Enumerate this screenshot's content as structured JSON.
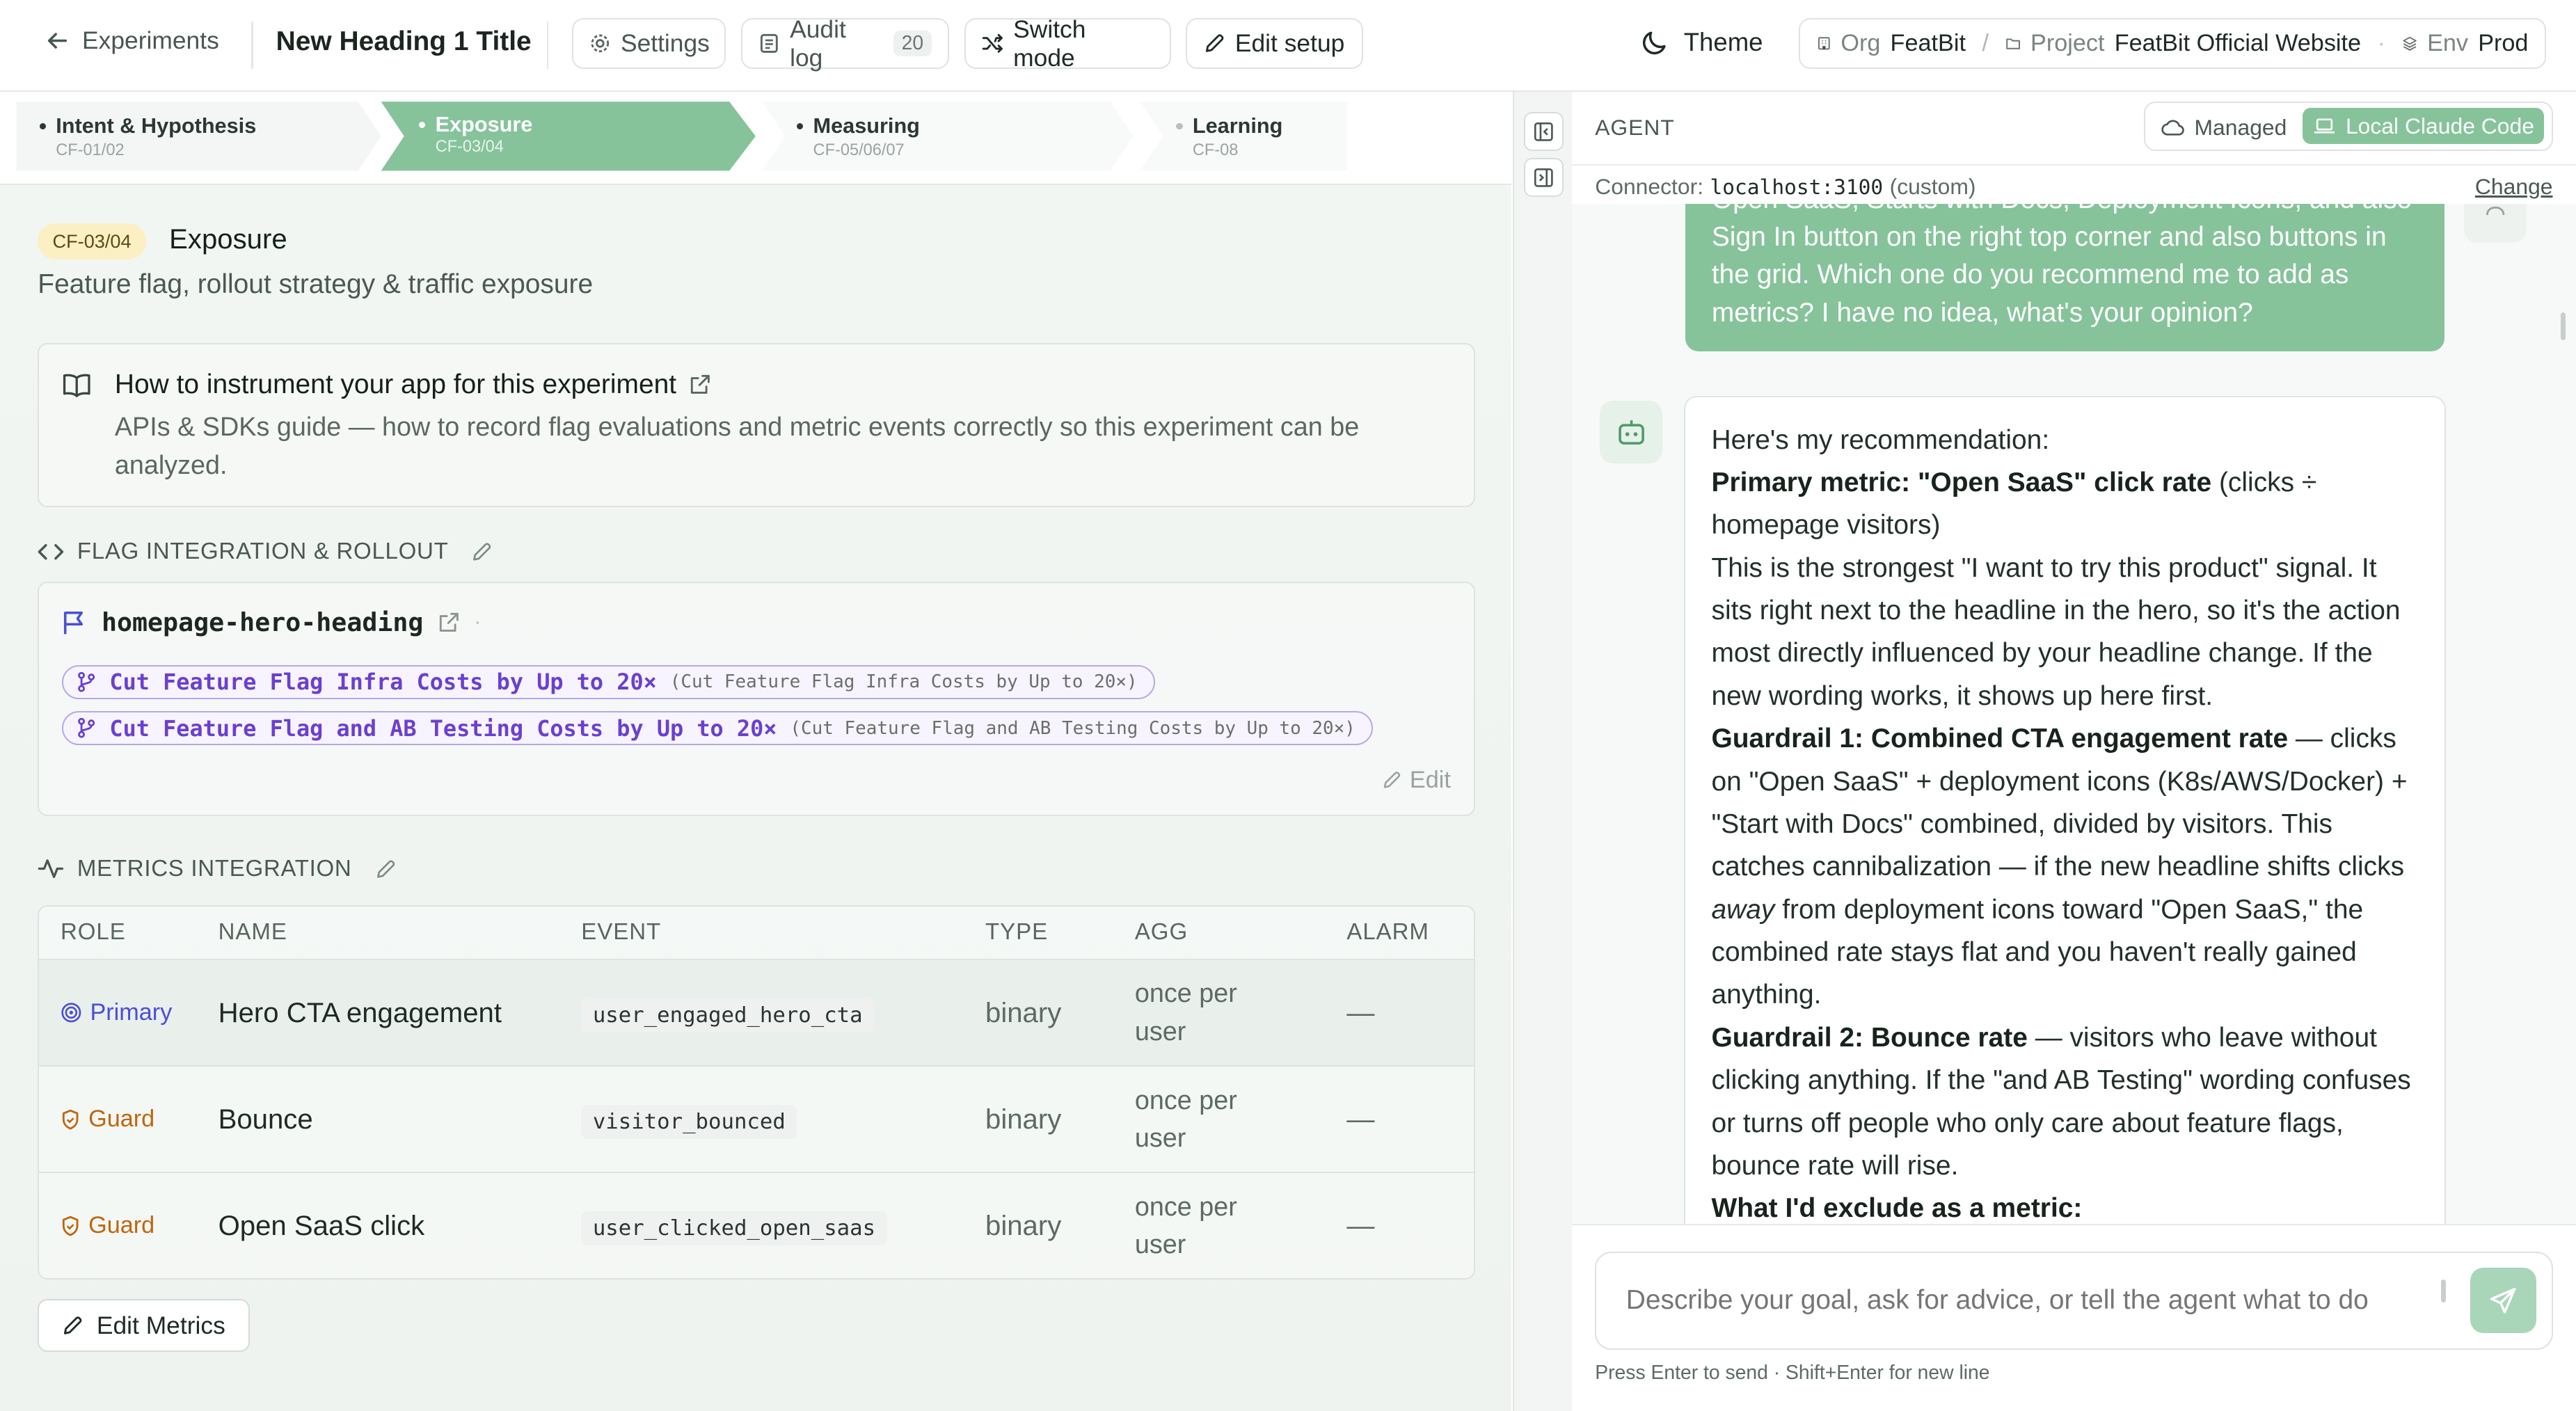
{
  "topbar": {
    "back_label": "Experiments",
    "title": "New Heading 1 Title",
    "settings_label": "Settings",
    "audit_label": "Audit log",
    "audit_count": "20",
    "switch_label": "Switch mode",
    "edit_setup_label": "Edit setup",
    "theme_label": "Theme",
    "org_key": "Org",
    "org_value": "FeatBit",
    "sep": "/",
    "project_key": "Project",
    "project_value": "FeatBit Official Website",
    "env_key": "Env",
    "env_value": "Prod"
  },
  "stepper": [
    {
      "title": "Intent & Hypothesis",
      "sub": "CF-01/02"
    },
    {
      "title": "Exposure",
      "sub": "CF-03/04"
    },
    {
      "title": "Measuring",
      "sub": "CF-05/06/07"
    },
    {
      "title": "Learning",
      "sub": "CF-08"
    }
  ],
  "exposure": {
    "badge": "CF-03/04",
    "title": "Exposure",
    "subtitle": "Feature flag, rollout strategy & traffic exposure"
  },
  "guide": {
    "title": "How to instrument your app for this experiment",
    "desc": "APIs & SDKs guide — how to record flag evaluations and metric events correctly so this experiment can be analyzed."
  },
  "flag_section": {
    "heading": "FLAG INTEGRATION & ROLLOUT",
    "flag_key": "homepage-hero-heading",
    "variants": [
      {
        "name": "Cut Feature Flag Infra Costs by Up to 20×",
        "value": "(Cut Feature Flag Infra Costs by Up to 20×)"
      },
      {
        "name": "Cut Feature Flag and AB Testing Costs by Up to 20×",
        "value": "(Cut Feature Flag and AB Testing Costs by Up to 20×)"
      }
    ],
    "edit_label": "Edit"
  },
  "metrics_section": {
    "heading": "METRICS INTEGRATION",
    "columns": [
      "ROLE",
      "NAME",
      "EVENT",
      "TYPE",
      "AGG",
      "ALARM"
    ],
    "rows": [
      {
        "role": "Primary",
        "name": "Hero CTA engagement",
        "event": "user_engaged_hero_cta",
        "type": "binary",
        "agg": "once per user",
        "alarm": "—"
      },
      {
        "role": "Guard",
        "name": "Bounce",
        "event": "visitor_bounced",
        "type": "binary",
        "agg": "once per user",
        "alarm": "—"
      },
      {
        "role": "Guard",
        "name": "Open SaaS click",
        "event": "user_clicked_open_saas",
        "type": "binary",
        "agg": "once per user",
        "alarm": "—"
      }
    ],
    "edit_metrics_label": "Edit Metrics"
  },
  "agent": {
    "label": "AGENT",
    "mode_managed": "Managed",
    "mode_local": "Local Claude Code",
    "connector_label": "Connector:",
    "connector_value": "localhost:3100",
    "connector_note": "(custom)",
    "change_label": "Change",
    "user_message": "Open SaaS, Starts with Docs, Deployment Icons, and also Sign In button on the right top corner and also buttons in the grid. Which one do you recommend me to add as metrics? I have no idea, what's your opinion?",
    "bot": {
      "intro": "Here's my recommendation:",
      "p1_bold": "Primary metric: \"Open SaaS\" click rate",
      "p1_rest": " (clicks ÷ homepage visitors)",
      "p2": "This is the strongest \"I want to try this product\" signal. It sits right next to the headline in the hero, so it's the action most directly influenced by your headline change. If the new wording works, it shows up here first.",
      "p3_bold": "Guardrail 1: Combined CTA engagement rate",
      "p3_pre": " — clicks on \"Open SaaS\" + deployment icons (K8s/AWS/Docker) + \"Start with Docs\" combined, divided by visitors. This catches cannibalization — if the new headline shifts clicks ",
      "p3_em": "away",
      "p3_post": " from deployment icons toward \"Open SaaS,\" the combined rate stays flat and you haven't really gained anything.",
      "p4_bold": "Guardrail 2: Bounce rate",
      "p4_rest": " — visitors who leave without clicking anything. If the \"and AB Testing\" wording confuses or turns off people who only care about feature flags, bounce rate will rise.",
      "p5_bold": "What I'd exclude as a metric:"
    },
    "input_placeholder": "Describe your goal, ask for advice, or tell the agent what to do",
    "hint": "Press Enter to send · Shift+Enter for new line"
  },
  "colors": {
    "accent_green": "#86c39b",
    "active_step": "#86c39b",
    "primary_role": "#4b4fd6",
    "guard_role": "#c0660f",
    "variant_purple": "#6b3fd1"
  }
}
